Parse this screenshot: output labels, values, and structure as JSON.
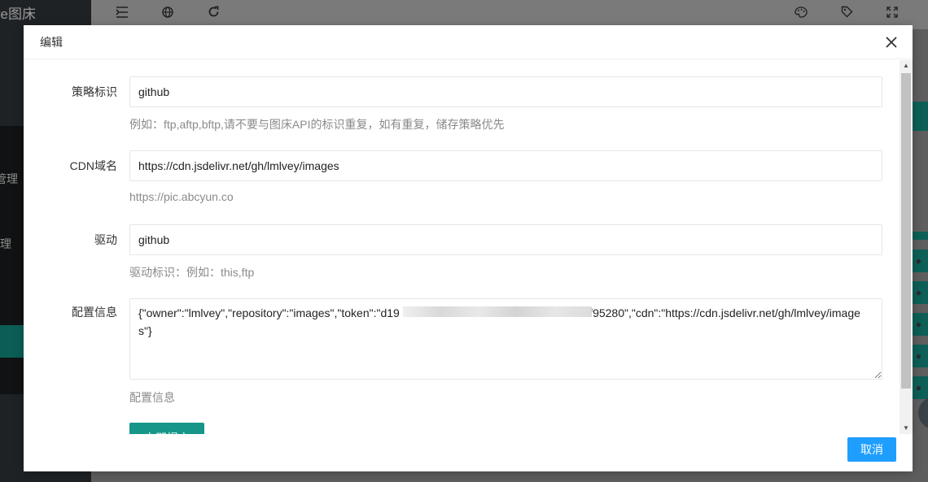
{
  "background": {
    "logo_text": "ve图床",
    "sidebar_items": [
      {
        "label": "管理"
      },
      {
        "label": "理"
      }
    ],
    "topbar_icons": [
      "menu-fold-icon",
      "globe-icon",
      "refresh-icon",
      "palette-icon",
      "tag-icon",
      "fullscreen-icon"
    ]
  },
  "modal": {
    "title": "编辑",
    "fields": [
      {
        "label": "策略标识",
        "value": "github",
        "aux": "例如：ftp,aftp,bftp,请不要与图床API的标识重复，如有重复，储存策略优先"
      },
      {
        "label": "CDN域名",
        "value": "https://cdn.jsdelivr.net/gh/lmlvey/images",
        "aux": "https://pic.abcyun.co"
      },
      {
        "label": "驱动",
        "value": "github",
        "aux": "驱动标识：例如：this,ftp"
      },
      {
        "label": "配置信息",
        "value": "{\"owner\":\"lmlvey\",\"repository\":\"images\",\"token\":\"d19                                                            f95280\",\"cdn\":\"https://cdn.jsdelivr.net/gh/lmlvey/images\"}",
        "aux": "配置信息"
      }
    ],
    "submit_label": "立即提交",
    "cancel_label": "取消"
  },
  "colors": {
    "primary_green": "#159688",
    "cancel_blue": "#1e9fff",
    "sidebar_dark": "#1f2225"
  }
}
